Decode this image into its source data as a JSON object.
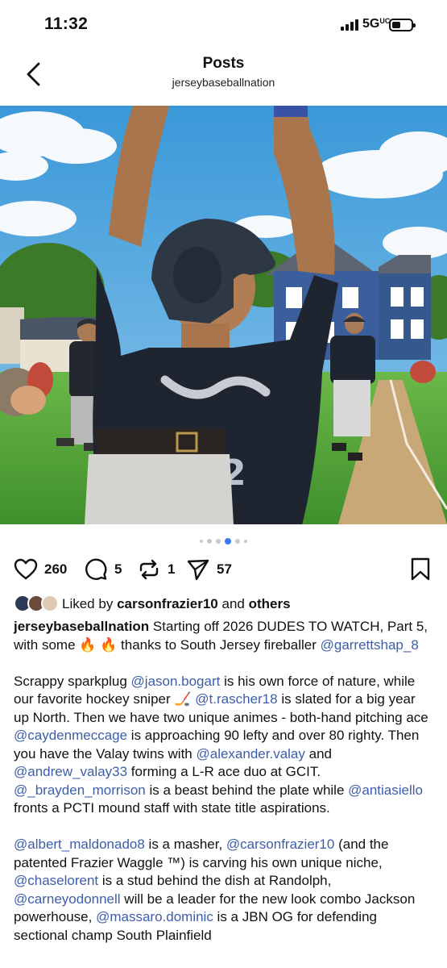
{
  "status": {
    "time": "11:32",
    "network": "5G",
    "network_suffix": "UC"
  },
  "header": {
    "title": "Posts",
    "subtitle": "jerseybaseballnation"
  },
  "carousel": {
    "total": 6,
    "active_index": 3
  },
  "actions": {
    "likes": "260",
    "comments": "5",
    "reposts": "1",
    "shares": "57"
  },
  "liked_by": {
    "prefix": "Liked by",
    "user": "carsonfrazier10",
    "conjunction": "and",
    "others": "others"
  },
  "caption": {
    "username": "jerseybaseballnation",
    "p1_text1": "Starting off 2026 DUDES TO WATCH, Part 5, with some ",
    "p1_emoji": "🔥 🔥",
    "p1_text2": " thanks to South Jersey fireballer ",
    "p1_mention1": "@garrettshap_8",
    "p2_t1": "Scrappy sparkplug ",
    "p2_m1": "@jason.bogart",
    "p2_t2": " is his own force of nature, while our favorite hockey sniper ",
    "p2_emoji": "🏒",
    "p2_t3": " ",
    "p2_m2": "@t.rascher18",
    "p2_t4": " is slated for a big year up North. Then we have two unique animes - both-hand pitching ace ",
    "p2_m3": "@caydenmeccage",
    "p2_t5": " is approaching 90 lefty and over 80 righty. Then you have the Valay twins with ",
    "p2_m4": "@alexander.valay",
    "p2_t6": " and ",
    "p2_m5": "@andrew_valay33",
    "p2_t7": " forming a L-R ace duo at GCIT. ",
    "p2_m6": "@_brayden_morrison",
    "p2_t8": " is a beast behind the plate while ",
    "p2_m7": "@antiasiello",
    "p2_t9": " fronts a PCTI mound staff with state title aspirations.",
    "p3_m1": "@albert_maldonado8",
    "p3_t1": " is a masher, ",
    "p3_m2": "@carsonfrazier10",
    "p3_t2": " (and the patented Frazier Waggle ™) is carving his own unique niche, ",
    "p3_m3": "@chaselorent",
    "p3_t3": " is a stud behind the dish at Randolph, ",
    "p3_m4": "@carneyodonnell",
    "p3_t4": " will be a leader for the new look combo Jackson powerhouse, ",
    "p3_m5": "@massaro.dominic",
    "p3_t5": " is a JBN OG for defending sectional champ South Plainfield"
  },
  "colors": {
    "mention": "#3d5ea8",
    "active_dot": "#3a7af0",
    "sky": "#3f9fd9",
    "grass": "#5aa83a",
    "house": "#3a5f9c",
    "jersey": "#1e2530"
  }
}
